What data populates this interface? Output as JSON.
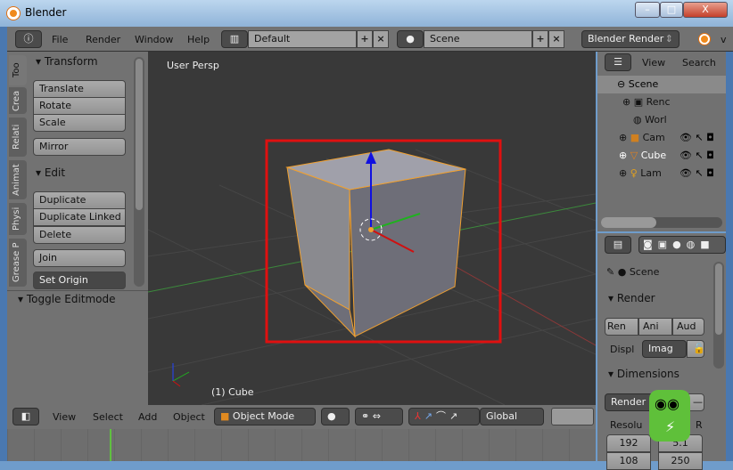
{
  "window": {
    "title": "Blender",
    "buttons": [
      "–",
      "□",
      "X"
    ]
  },
  "topbar": {
    "menus": [
      "File",
      "Render",
      "Window",
      "Help"
    ],
    "layout": "Default",
    "scene": "Scene",
    "engine": "Blender Render",
    "version_partial": "v"
  },
  "toolshelf": {
    "tabs": [
      "Too",
      "Crea",
      "Relati",
      "Animat",
      "Physi",
      "Grease P"
    ],
    "transform": {
      "title": "Transform",
      "buttons": [
        "Translate",
        "Rotate",
        "Scale",
        "Mirror"
      ]
    },
    "edit": {
      "title": "Edit",
      "buttons": [
        "Duplicate",
        "Duplicate Linked",
        "Delete",
        "Join"
      ],
      "set_origin": "Set Origin"
    },
    "toggle": "Toggle Editmode"
  },
  "viewport": {
    "view_label": "User Persp",
    "object_label": "(1) Cube",
    "highlight_color": "#e01010"
  },
  "viewport_header": {
    "menus": [
      "View",
      "Select",
      "Add",
      "Object"
    ],
    "mode": "Object Mode",
    "orientation": "Global"
  },
  "outliner": {
    "menus": [
      "View",
      "Search"
    ],
    "items": [
      "Scene",
      "Renc",
      "Worl",
      "Cam",
      "Cube",
      "Lam"
    ]
  },
  "properties": {
    "scene": "Scene",
    "render_panel": "Render",
    "render_buttons": [
      "Ren",
      "Ani",
      "Aud"
    ],
    "display_label": "Displ",
    "display_value": "Imag",
    "dimensions_panel": "Dimensions",
    "render_preset": "Render P",
    "resolution_label": "Resolu",
    "aspect_label": "R",
    "res_x": "192",
    "res_y": "108",
    "aspect_x": "5.1",
    "percent": "250"
  }
}
